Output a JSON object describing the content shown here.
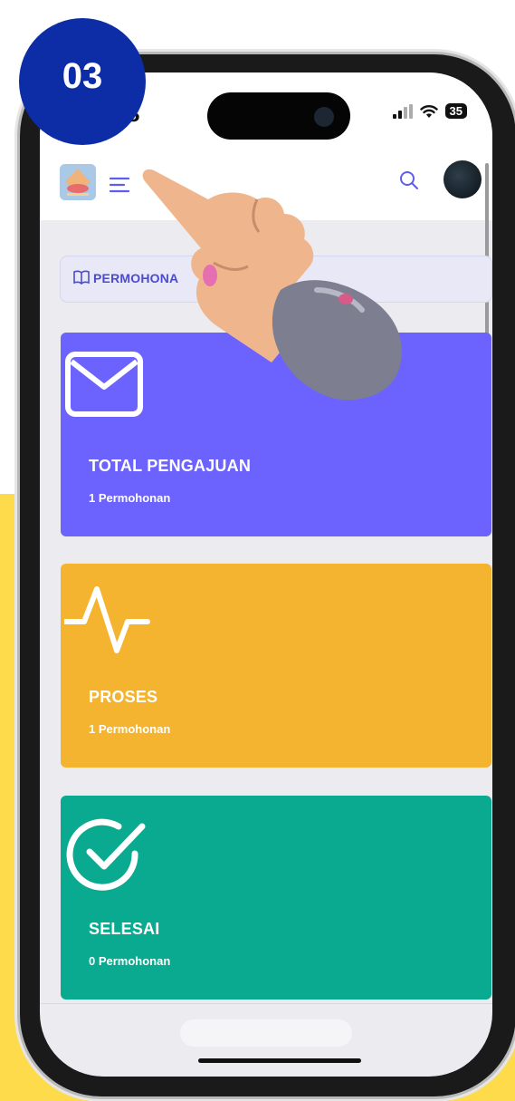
{
  "step_badge": {
    "label": "03"
  },
  "status_bar": {
    "time": "8",
    "battery": "35"
  },
  "header": {
    "logo": "logo",
    "menu_icon": "hamburger-icon",
    "search_icon": "search-icon",
    "avatar": "avatar"
  },
  "breadcrumb": {
    "icon": "book-icon",
    "label": "PERMOHONA"
  },
  "cards": [
    {
      "title": "TOTAL PENGAJUAN",
      "subtitle": "1 Permohonan",
      "icon": "mail-icon",
      "color": "#6c63ff"
    },
    {
      "title": "PROSES",
      "subtitle": "1 Permohonan",
      "icon": "activity-icon",
      "color": "#f4b430"
    },
    {
      "title": "SELESAI",
      "subtitle": "0 Permohonan",
      "icon": "check-circle-icon",
      "color": "#09aa8f"
    }
  ],
  "colors": {
    "accent": "#4b4bd1",
    "badge": "#0c2da6",
    "background_yellow": "#fedb4a"
  }
}
